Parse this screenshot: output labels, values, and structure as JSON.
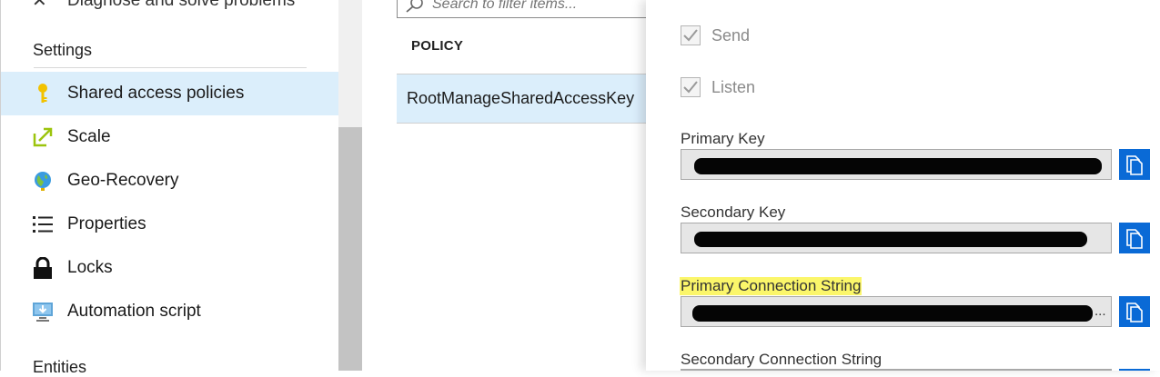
{
  "nav": {
    "top_partial_item": "Diagnose and solve problems",
    "settings_label": "Settings",
    "entities_label": "Entities",
    "items": [
      {
        "label": "Shared access policies",
        "icon": "key-icon",
        "active": true
      },
      {
        "label": "Scale",
        "icon": "scale-arrow-icon",
        "active": false
      },
      {
        "label": "Geo-Recovery",
        "icon": "globe-icon",
        "active": false
      },
      {
        "label": "Properties",
        "icon": "list-icon",
        "active": false
      },
      {
        "label": "Locks",
        "icon": "lock-icon",
        "active": false
      },
      {
        "label": "Automation script",
        "icon": "monitor-download-icon",
        "active": false
      }
    ]
  },
  "middle": {
    "search_placeholder": "Search to filter items...",
    "column_header": "POLICY",
    "rows": [
      "RootManageSharedAccessKey"
    ]
  },
  "blade": {
    "claims": [
      {
        "label": "Send",
        "checked": true
      },
      {
        "label": "Listen",
        "checked": true
      }
    ],
    "fields": [
      {
        "label": "Primary Key",
        "highlighted": false
      },
      {
        "label": "Secondary Key",
        "highlighted": false
      },
      {
        "label": "Primary Connection String",
        "highlighted": true
      },
      {
        "label": "Secondary Connection String",
        "highlighted": false
      }
    ]
  },
  "colors": {
    "active_bg": "#dbeefb",
    "accent": "#0a6ad6",
    "highlight": "#fbf66a",
    "key_icon": "#f2c200",
    "scale_icon": "#9cc40d"
  }
}
